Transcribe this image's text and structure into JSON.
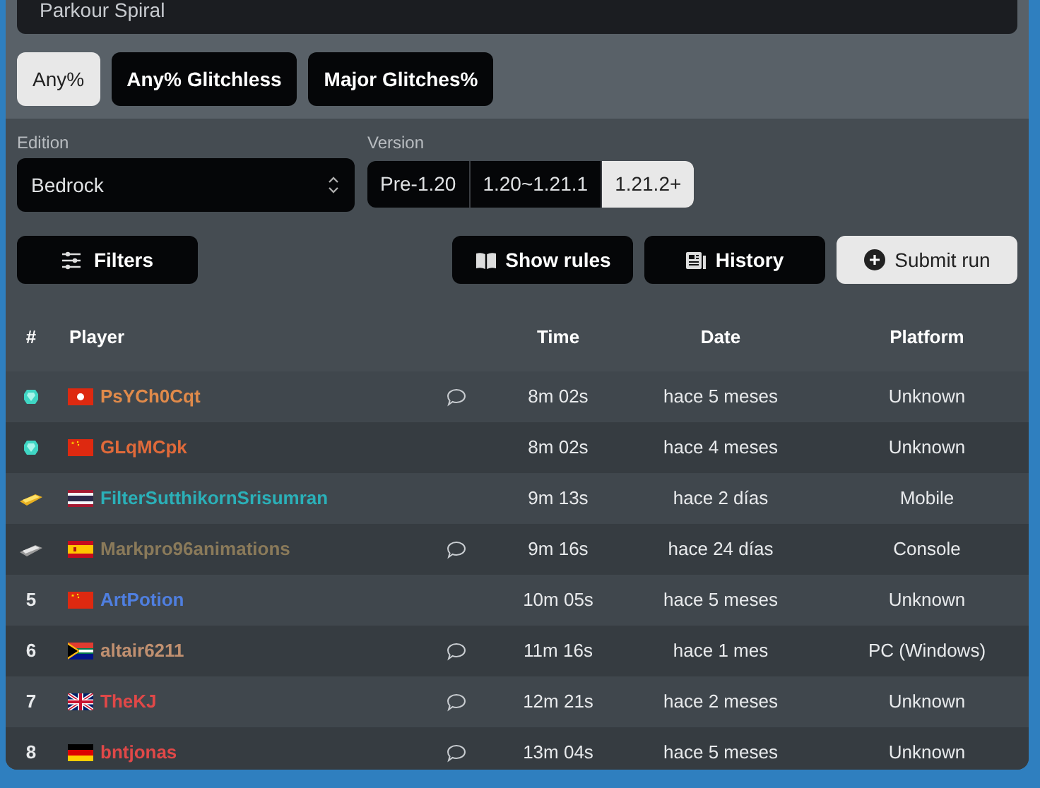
{
  "search": {
    "value": "Parkour Spiral"
  },
  "categories": [
    {
      "label": "Any%",
      "selected": true
    },
    {
      "label": "Any% Glitchless",
      "selected": false
    },
    {
      "label": "Major Glitches%",
      "selected": false
    }
  ],
  "edition": {
    "label": "Edition",
    "value": "Bedrock"
  },
  "version": {
    "label": "Version",
    "options": [
      {
        "label": "Pre-1.20",
        "selected": false
      },
      {
        "label": "1.20~1.21.1",
        "selected": false
      },
      {
        "label": "1.21.2+",
        "selected": true
      }
    ]
  },
  "actions": {
    "filters": "Filters",
    "show_rules": "Show rules",
    "history": "History",
    "submit": "Submit run"
  },
  "table": {
    "columns": [
      "#",
      "Player",
      "Time",
      "Date",
      "Platform"
    ],
    "rows": [
      {
        "rank": {
          "kind": "diamond"
        },
        "flag": {
          "kind": "hk"
        },
        "player": "PsYCh0Cqt",
        "color": "#e08a4a",
        "comment": true,
        "time": "8m 02s",
        "date": "hace 5 meses",
        "platform": "Unknown"
      },
      {
        "rank": {
          "kind": "diamond"
        },
        "flag": {
          "kind": "cn"
        },
        "player": "GLqMCpk",
        "color": "#e06a3a",
        "comment": false,
        "time": "8m 02s",
        "date": "hace 4 meses",
        "platform": "Unknown"
      },
      {
        "rank": {
          "kind": "gold"
        },
        "flag": {
          "kind": "th"
        },
        "player": "FilterSutthikornSrisumran",
        "color": "#2bb0b8",
        "comment": false,
        "time": "9m 13s",
        "date": "hace 2 días",
        "platform": "Mobile"
      },
      {
        "rank": {
          "kind": "iron"
        },
        "flag": {
          "kind": "es"
        },
        "player": "Markpro96animations",
        "color": "#8a7a5a",
        "comment": true,
        "time": "9m 16s",
        "date": "hace 24 días",
        "platform": "Console"
      },
      {
        "rank": {
          "kind": "number",
          "text": "5"
        },
        "flag": {
          "kind": "cn"
        },
        "player": "ArtPotion",
        "color": "#4f7fe0",
        "comment": false,
        "time": "10m 05s",
        "date": "hace 5 meses",
        "platform": "Unknown"
      },
      {
        "rank": {
          "kind": "number",
          "text": "6"
        },
        "flag": {
          "kind": "za"
        },
        "player": "altair6211",
        "color": "#c09070",
        "comment": true,
        "time": "11m 16s",
        "date": "hace 1 mes",
        "platform": "PC (Windows)"
      },
      {
        "rank": {
          "kind": "number",
          "text": "7"
        },
        "flag": {
          "kind": "gb"
        },
        "player": "TheKJ",
        "color": "#e04848",
        "comment": true,
        "time": "12m 21s",
        "date": "hace 2 meses",
        "platform": "Unknown"
      },
      {
        "rank": {
          "kind": "number",
          "text": "8"
        },
        "flag": {
          "kind": "de"
        },
        "player": "bntjonas",
        "color": "#e04848",
        "comment": true,
        "time": "13m 04s",
        "date": "hace 5 meses",
        "platform": "Unknown"
      }
    ]
  }
}
